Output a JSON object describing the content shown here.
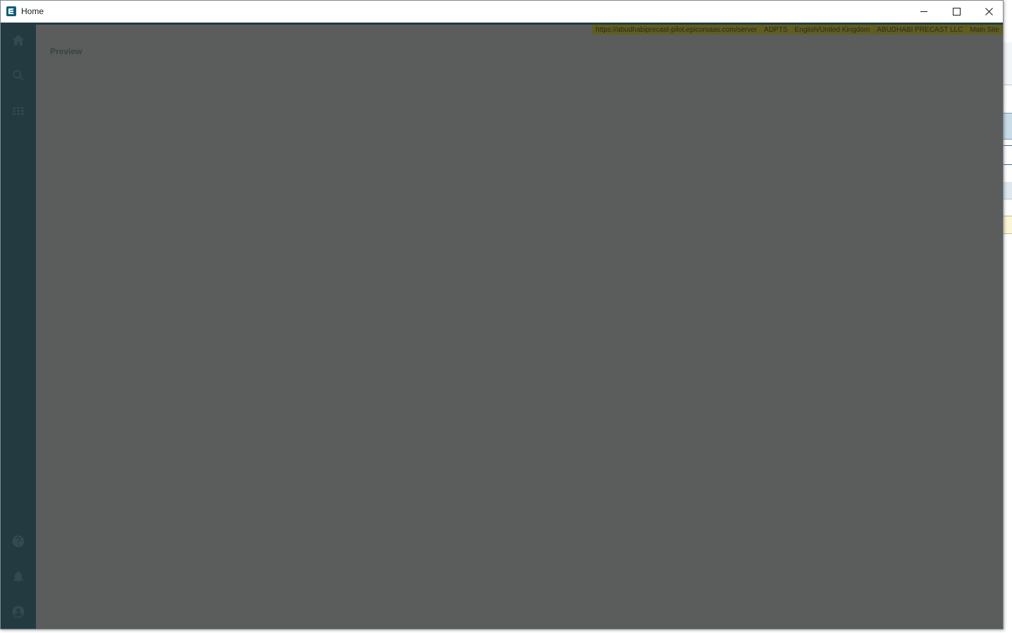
{
  "window": {
    "title": "Home"
  },
  "info_bar": {
    "server_url": "https://abudhabiprecast-pilot.epicorsaas.com/server",
    "user": "ADPTS",
    "language": "English/United Kingdom",
    "company": "ABUDHABI PRECAST LLC",
    "site": "Main Site"
  },
  "main": {
    "preview_label": "Preview"
  },
  "sidebar": {
    "top_icons": [
      "home-icon",
      "search-icon",
      "apps-grid-icon"
    ],
    "bottom_icons": [
      "help-icon",
      "notifications-bell-icon",
      "user-account-icon"
    ]
  },
  "colors": {
    "overlay": "#5a5d5b",
    "sidebar": "#243a41",
    "info_bar": "#5f5d22",
    "brand": "#0e5d7a"
  }
}
